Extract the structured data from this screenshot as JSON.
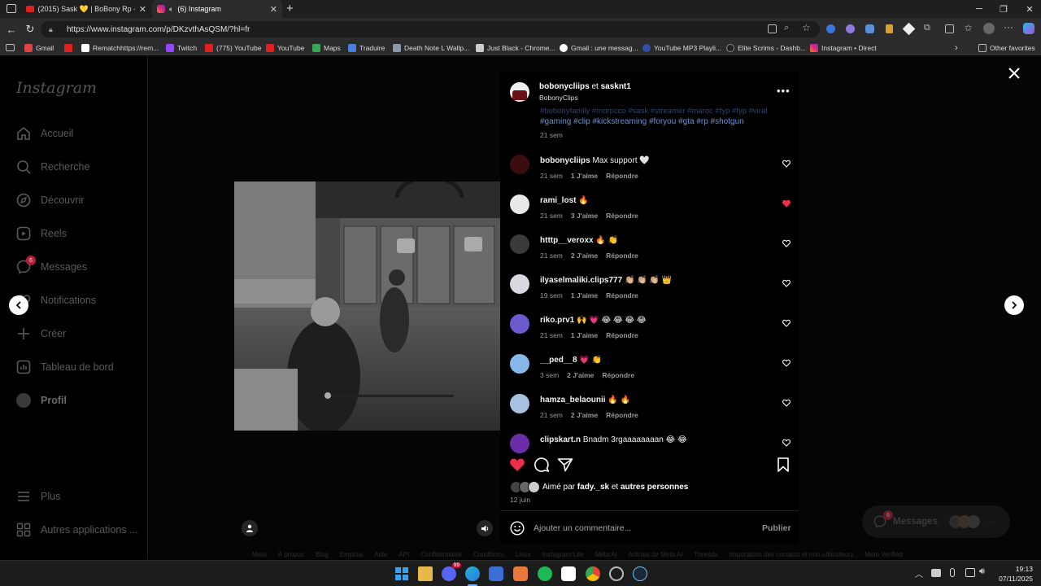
{
  "browser": {
    "tabs": [
      {
        "label": "(2015) Sask 💛 | BoBony Rp - You",
        "active": false
      },
      {
        "label": "(6) Instagram",
        "active": true
      }
    ],
    "new_tab": "+",
    "url": "https://www.instagram.com/p/DKzvthAsQSM/?hl=fr",
    "bookmarks": [
      "Gmail",
      "Rematchhttps://rem...",
      "Twitch",
      "(775) YouTube",
      "YouTube",
      "Maps",
      "Traduire",
      "Death Note L Wallp...",
      "Just Black - Chrome...",
      "Gmail : une messag...",
      "YouTube MP3 Playli...",
      "Elite Scrims - Dashb...",
      "Instagram • Direct"
    ],
    "other_favorites": "Other favorites"
  },
  "sidebar": {
    "logo": "Instagram",
    "items": [
      {
        "label": "Accueil",
        "icon": "home-icon"
      },
      {
        "label": "Recherche",
        "icon": "search-icon"
      },
      {
        "label": "Découvrir",
        "icon": "compass-icon"
      },
      {
        "label": "Reels",
        "icon": "reels-icon"
      },
      {
        "label": "Messages",
        "icon": "messenger-icon",
        "badge": "6"
      },
      {
        "label": "Notifications",
        "icon": "heart-icon"
      },
      {
        "label": "Créer",
        "icon": "plus-icon"
      },
      {
        "label": "Tableau de bord",
        "icon": "dashboard-icon"
      },
      {
        "label": "Profil",
        "icon": "avatar"
      },
      {
        "label": "Plus",
        "icon": "menu-icon"
      },
      {
        "label": "Autres applications ...",
        "icon": "apps-icon"
      }
    ]
  },
  "post": {
    "author_line": "bobonycliips",
    "conjunction": "et",
    "coauthor": "sasknt1",
    "subtitle": "BobonyClips",
    "caption_faded": "#bobonyfamily #morocco #sask #streamer #maroc #fyp #fyp #viral",
    "hashtags": "#gaming #clip #kickstreaming #foryou #gta #rp #shotgun",
    "caption_time": "21 sem",
    "likes_prefix": "Aimé par",
    "likes_user": "fady._sk",
    "likes_and": "et",
    "likes_others": "autres personnes",
    "date": "12 juin",
    "comment_placeholder": "Ajouter un commentaire...",
    "publish": "Publier"
  },
  "comments": [
    {
      "user": "bobonycliips",
      "text": "Max support 🤍",
      "time": "21 sem",
      "likes": "1 J'aime",
      "reply": "Répondre",
      "liked": false
    },
    {
      "user": "rami_lost",
      "text": "🔥",
      "time": "21 sem",
      "likes": "3 J'aime",
      "reply": "Répondre",
      "liked": true
    },
    {
      "user": "htttp__veroxx",
      "text": "🔥 👏",
      "time": "21 sem",
      "likes": "2 J'aime",
      "reply": "Répondre",
      "liked": false
    },
    {
      "user": "ilyaselmaliki.clips777",
      "text": "👏🏼 👏🏼 👏🏼 👑",
      "time": "19 sem",
      "likes": "1 J'aime",
      "reply": "Répondre",
      "liked": false
    },
    {
      "user": "riko.prv1",
      "text": "🙌 💗 😂 😂 😂 😂",
      "time": "21 sem",
      "likes": "1 J'aime",
      "reply": "Répondre",
      "liked": false
    },
    {
      "user": "__ped__8",
      "text": "💗 👏",
      "time": "3 sem",
      "likes": "2 J'aime",
      "reply": "Répondre",
      "liked": false
    },
    {
      "user": "hamza_belaounii",
      "text": "🔥 🔥",
      "time": "21 sem",
      "likes": "2 J'aime",
      "reply": "Répondre",
      "liked": false
    },
    {
      "user": "clipskart.n",
      "text": "Bnadm 3rgaaaaaaaan 😂 😂",
      "time": "",
      "likes": "",
      "reply": "",
      "liked": false
    }
  ],
  "messages_pill": {
    "label": "Messages",
    "badge": "6"
  },
  "footer_links": [
    "Meta",
    "À propos",
    "Blog",
    "Emplois",
    "Aide",
    "API",
    "Confidentialité",
    "Conditions",
    "Lieux",
    "Instagram Lite",
    "Meta AI",
    "Articles de Meta AI",
    "Threads",
    "Importation des contacts et non-utilisateurs",
    "Meta Verified"
  ],
  "taskbar": {
    "time": "19:13",
    "date": "07/11/2025",
    "discord_badge": "99"
  },
  "colors": {
    "liked": "#ed2e4b",
    "link": "#6d8fd6",
    "badge": "#b3203a"
  }
}
